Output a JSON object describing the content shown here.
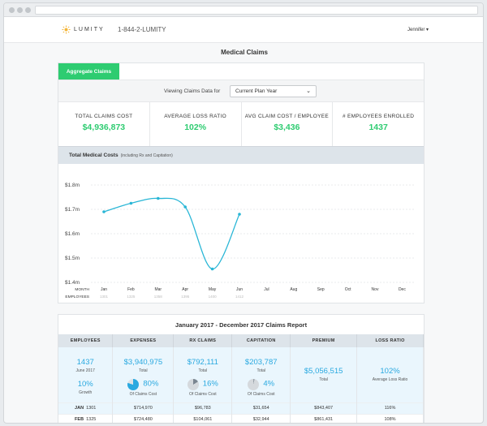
{
  "header": {
    "brand": "LUMITY",
    "phone": "1-844-2-LUMITY",
    "user": "Jennifer"
  },
  "page_title": "Medical Claims",
  "tab": "Aggregate Claims",
  "filter": {
    "label": "Viewing Claims Data for",
    "selected": "Current Plan Year"
  },
  "kpis": [
    {
      "label": "TOTAL CLAIMS COST",
      "value": "$4,936,873"
    },
    {
      "label": "AVERAGE LOSS RATIO",
      "value": "102%"
    },
    {
      "label": "AVG CLAIM COST / EMPLOYEE",
      "value": "$3,436"
    },
    {
      "label": "# EMPLOYEES ENROLLED",
      "value": "1437"
    }
  ],
  "chart_header": {
    "title": "Total Medical Costs",
    "subtitle": "(including Rx and Capitation)"
  },
  "chart_data": {
    "type": "line",
    "categories": [
      "Jan",
      "Feb",
      "Mar",
      "Apr",
      "May",
      "Jun",
      "Jul",
      "Aug",
      "Sep",
      "Oct",
      "Nov",
      "Dec"
    ],
    "employees": [
      "1301",
      "1325",
      "1358",
      "1395",
      "1400",
      "1412",
      "",
      "",
      "",
      "",
      "",
      ""
    ],
    "series": [
      {
        "values": [
          1.69,
          1.725,
          1.745,
          1.71,
          1.455,
          1.68
        ]
      }
    ],
    "y_ticks": [
      "$1.8m",
      "$1.7m",
      "$1.6m",
      "$1.5m",
      "$1.4m"
    ],
    "ylim": [
      1.4,
      1.8
    ],
    "row_labels": [
      "MONTH",
      "EMPLOYEES"
    ],
    "grid": true,
    "color": "#29b6d6"
  },
  "report": {
    "title": "January 2017 - December 2017 Claims Report",
    "columns": [
      "EMPLOYEES",
      "EXPENSES",
      "RX CLAIMS",
      "CAPITATION",
      "PREMIUM",
      "LOSS RATIO"
    ],
    "summary": {
      "employees": {
        "value": "1437",
        "sub": "June 2017",
        "growth": "10%",
        "growth_label": "Growth"
      },
      "expenses": {
        "value": "$3,940,975",
        "sub": "Total",
        "pct": "80%",
        "pct_label": "Of Claims Cost"
      },
      "rx": {
        "value": "$792,111",
        "sub": "Total",
        "pct": "16%",
        "pct_label": "Of Claims Cost"
      },
      "capitation": {
        "value": "$203,787",
        "sub": "Total",
        "pct": "4%",
        "pct_label": "Of Claims Cost"
      },
      "premium": {
        "value": "$5,056,515",
        "sub": "Total"
      },
      "loss": {
        "value": "102%",
        "sub": "Average Loss Ratio"
      }
    },
    "rows": [
      {
        "month": "JAN",
        "emp": "1301",
        "exp": "$714,970",
        "rx": "$96,783",
        "cap": "$31,654",
        "prem": "$843,407",
        "loss": "116%"
      },
      {
        "month": "FEB",
        "emp": "1325",
        "exp": "$724,480",
        "rx": "$104,061",
        "cap": "$32,944",
        "prem": "$861,431",
        "loss": "108%"
      }
    ]
  },
  "colors": {
    "green": "#2ecc71",
    "blue": "#2aa9e0",
    "line": "#29b6d6"
  }
}
